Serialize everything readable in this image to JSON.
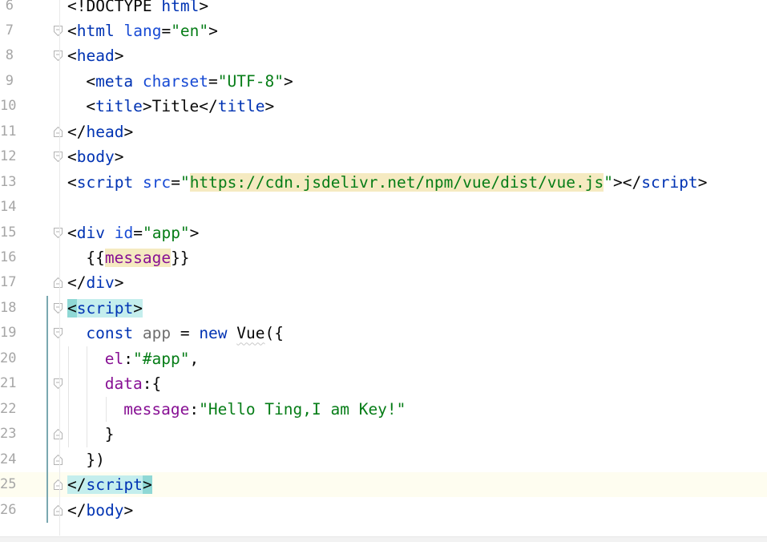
{
  "editor": {
    "language": "HTML",
    "current_line": "25",
    "lines": [
      {
        "number": "6",
        "fold": "",
        "indent": 0,
        "tokens": [
          {
            "t": "<!DOCTYPE ",
            "c": "punct"
          },
          {
            "t": "html",
            "c": "tag"
          },
          {
            "t": ">",
            "c": "punct"
          }
        ]
      },
      {
        "number": "7",
        "fold": "open",
        "indent": 0,
        "tokens": [
          {
            "t": "<",
            "c": "punct"
          },
          {
            "t": "html",
            "c": "tag"
          },
          {
            "t": " ",
            "c": "punct"
          },
          {
            "t": "lang",
            "c": "attr"
          },
          {
            "t": "=",
            "c": "punct"
          },
          {
            "t": "\"en\"",
            "c": "str"
          },
          {
            "t": ">",
            "c": "punct"
          }
        ]
      },
      {
        "number": "8",
        "fold": "open",
        "indent": 0,
        "tokens": [
          {
            "t": "<",
            "c": "punct"
          },
          {
            "t": "head",
            "c": "tag"
          },
          {
            "t": ">",
            "c": "punct"
          }
        ]
      },
      {
        "number": "9",
        "fold": "",
        "indent": 1,
        "tokens": [
          {
            "t": "<",
            "c": "punct"
          },
          {
            "t": "meta",
            "c": "tag"
          },
          {
            "t": " ",
            "c": "punct"
          },
          {
            "t": "charset",
            "c": "attr"
          },
          {
            "t": "=",
            "c": "punct"
          },
          {
            "t": "\"UTF-8\"",
            "c": "str"
          },
          {
            "t": ">",
            "c": "punct"
          }
        ]
      },
      {
        "number": "10",
        "fold": "",
        "indent": 1,
        "tokens": [
          {
            "t": "<",
            "c": "punct"
          },
          {
            "t": "title",
            "c": "tag"
          },
          {
            "t": ">",
            "c": "punct"
          },
          {
            "t": "Title",
            "c": "ident"
          },
          {
            "t": "</",
            "c": "punct"
          },
          {
            "t": "title",
            "c": "tag"
          },
          {
            "t": ">",
            "c": "punct"
          }
        ]
      },
      {
        "number": "11",
        "fold": "close",
        "indent": 0,
        "tokens": [
          {
            "t": "</",
            "c": "punct"
          },
          {
            "t": "head",
            "c": "tag"
          },
          {
            "t": ">",
            "c": "punct"
          }
        ]
      },
      {
        "number": "12",
        "fold": "open",
        "indent": 0,
        "tokens": [
          {
            "t": "<",
            "c": "punct"
          },
          {
            "t": "body",
            "c": "tag"
          },
          {
            "t": ">",
            "c": "punct"
          }
        ]
      },
      {
        "number": "13",
        "fold": "",
        "indent": 0,
        "tokens": [
          {
            "t": "<",
            "c": "punct"
          },
          {
            "t": "script",
            "c": "tag"
          },
          {
            "t": " ",
            "c": "punct"
          },
          {
            "t": "src",
            "c": "attr"
          },
          {
            "t": "=",
            "c": "punct"
          },
          {
            "t": "\"",
            "c": "str"
          },
          {
            "t": "https://cdn.jsdelivr.net/npm/vue/dist/vue.js",
            "c": "str",
            "hl": "url"
          },
          {
            "t": "\"",
            "c": "str"
          },
          {
            "t": "></",
            "c": "punct"
          },
          {
            "t": "script",
            "c": "tag"
          },
          {
            "t": ">",
            "c": "punct"
          }
        ]
      },
      {
        "number": "14",
        "fold": "",
        "indent": 0,
        "tokens": []
      },
      {
        "number": "15",
        "fold": "open",
        "indent": 0,
        "tokens": [
          {
            "t": "<",
            "c": "punct"
          },
          {
            "t": "div",
            "c": "tag"
          },
          {
            "t": " ",
            "c": "punct"
          },
          {
            "t": "id",
            "c": "attr"
          },
          {
            "t": "=",
            "c": "punct"
          },
          {
            "t": "\"app\"",
            "c": "str"
          },
          {
            "t": ">",
            "c": "punct"
          }
        ]
      },
      {
        "number": "16",
        "fold": "",
        "indent": 1,
        "tokens": [
          {
            "t": "{{",
            "c": "punct"
          },
          {
            "t": "message",
            "c": "prop",
            "hl": "url"
          },
          {
            "t": "}}",
            "c": "punct"
          }
        ]
      },
      {
        "number": "17",
        "fold": "close",
        "indent": 0,
        "tokens": [
          {
            "t": "</",
            "c": "punct"
          },
          {
            "t": "div",
            "c": "tag"
          },
          {
            "t": ">",
            "c": "punct"
          }
        ]
      },
      {
        "number": "18",
        "fold": "open",
        "indent": 0,
        "tokens": [
          {
            "t": "<",
            "c": "punct",
            "hl": "bracket"
          },
          {
            "t": "script",
            "c": "tag",
            "hl": "match"
          },
          {
            "t": ">",
            "c": "punct",
            "hl": "match"
          }
        ]
      },
      {
        "number": "19",
        "fold": "open",
        "indent": 1,
        "tokens": [
          {
            "t": "const",
            "c": "kw"
          },
          {
            "t": " ",
            "c": "punct"
          },
          {
            "t": "app",
            "c": "var"
          },
          {
            "t": " = ",
            "c": "punct"
          },
          {
            "t": "new",
            "c": "kw"
          },
          {
            "t": " ",
            "c": "punct"
          },
          {
            "t": "Vue",
            "c": "ident",
            "hl": "squiggle"
          },
          {
            "t": "({",
            "c": "punct"
          }
        ]
      },
      {
        "number": "20",
        "fold": "",
        "indent": 2,
        "tokens": [
          {
            "t": "el",
            "c": "prop"
          },
          {
            "t": ":",
            "c": "punct"
          },
          {
            "t": "\"#app\"",
            "c": "str"
          },
          {
            "t": ",",
            "c": "punct"
          }
        ]
      },
      {
        "number": "21",
        "fold": "open",
        "indent": 2,
        "tokens": [
          {
            "t": "data",
            "c": "prop"
          },
          {
            "t": ":{",
            "c": "punct"
          }
        ]
      },
      {
        "number": "22",
        "fold": "",
        "indent": 3,
        "tokens": [
          {
            "t": "message",
            "c": "prop"
          },
          {
            "t": ":",
            "c": "punct"
          },
          {
            "t": "\"Hello Ting,I am Key!\"",
            "c": "str"
          }
        ]
      },
      {
        "number": "23",
        "fold": "close",
        "indent": 2,
        "tokens": [
          {
            "t": "}",
            "c": "punct"
          }
        ]
      },
      {
        "number": "24",
        "fold": "close",
        "indent": 1,
        "tokens": [
          {
            "t": "})",
            "c": "punct"
          }
        ]
      },
      {
        "number": "25",
        "fold": "close",
        "indent": 0,
        "tokens": [
          {
            "t": "</",
            "c": "punct",
            "hl": "match"
          },
          {
            "t": "script",
            "c": "tag",
            "hl": "match"
          },
          {
            "t": ">",
            "c": "punct",
            "hl": "bracket"
          }
        ]
      },
      {
        "number": "26",
        "fold": "close",
        "indent": 0,
        "tokens": [
          {
            "t": "</",
            "c": "punct"
          },
          {
            "t": "body",
            "c": "tag"
          },
          {
            "t": ">",
            "c": "punct"
          }
        ]
      }
    ]
  },
  "colors": {
    "tag": "#0033b3",
    "attribute": "#174ad4",
    "string": "#067d17",
    "property": "#871094",
    "line_number": "#a6a6a6",
    "current_line_bg": "#fefdf0",
    "url_highlight": "#f5eac1",
    "match_highlight": "#c4eeed"
  }
}
